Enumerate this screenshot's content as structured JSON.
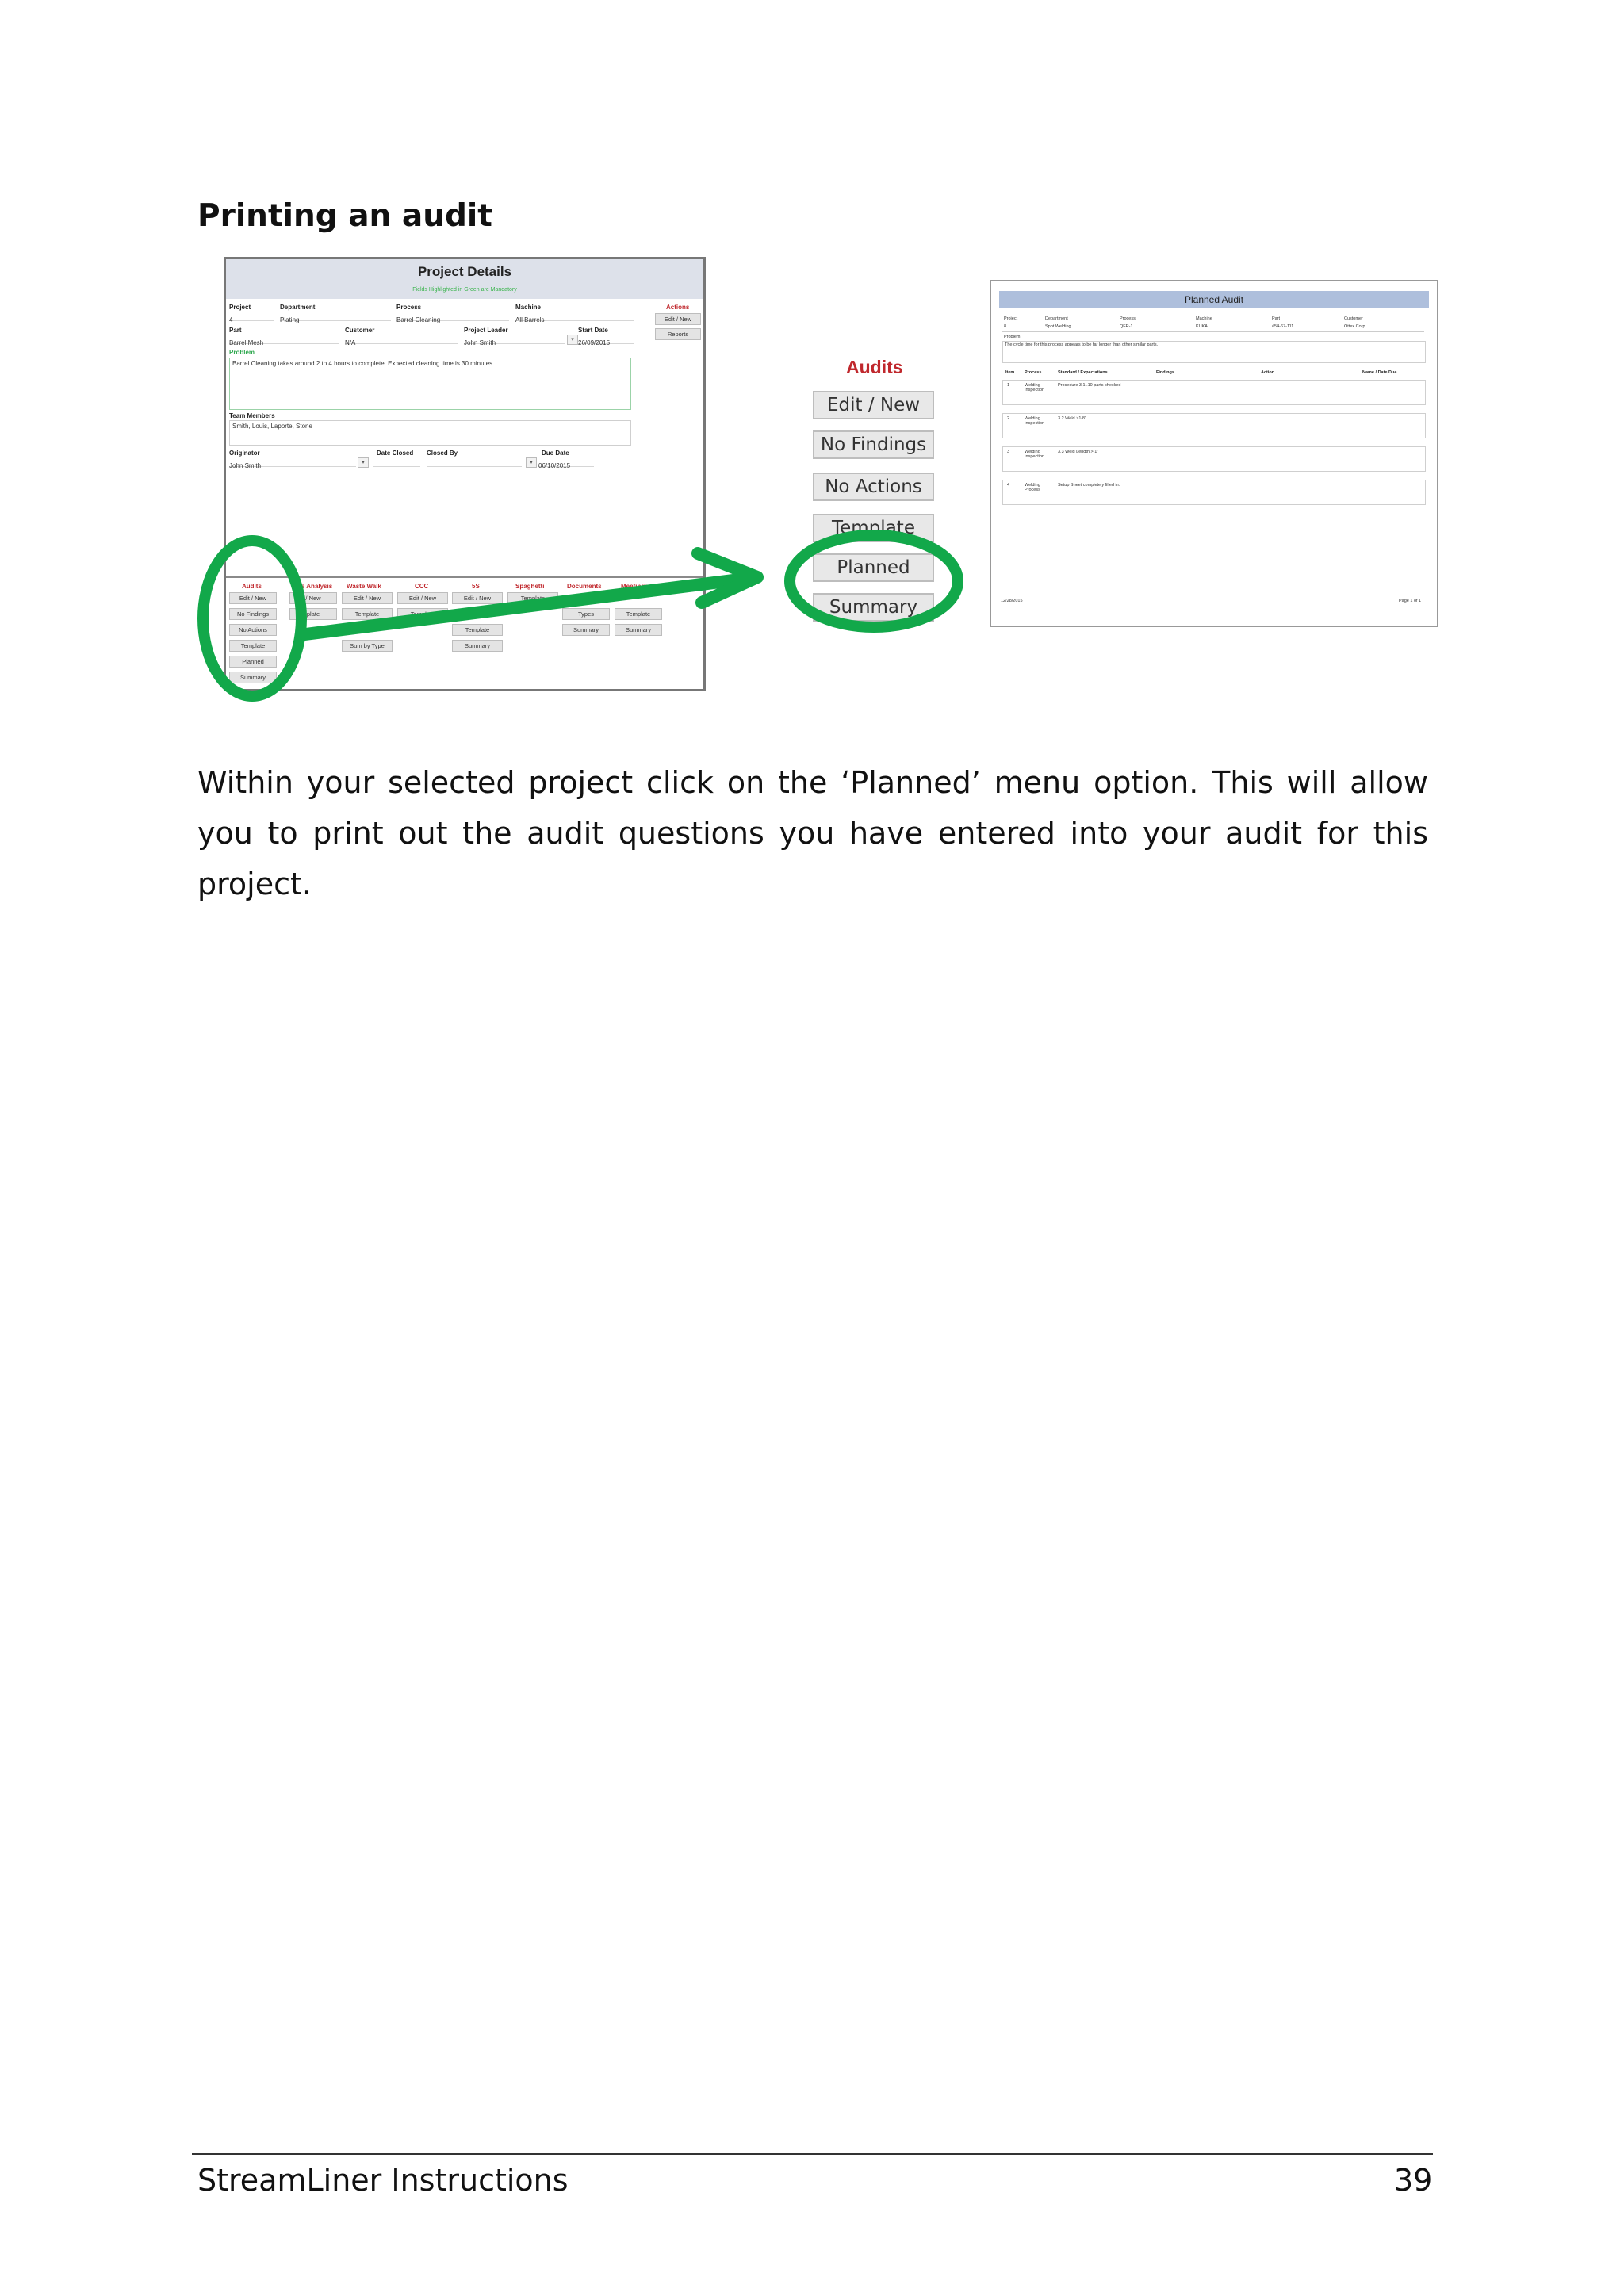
{
  "heading": "Printing an audit",
  "body_text": "Within your selected project click on the ‘Planned’ menu option. This will allow you to print out the audit questions you have entered into your audit for this project.",
  "footer": {
    "left": "StreamLiner Instructions",
    "right": "39"
  },
  "project_details": {
    "title": "Project Details",
    "subtitle": "Fields Highlighted in Green are Mandatory",
    "fields": {
      "project_label": "Project",
      "project_value": "4",
      "department_label": "Department",
      "department_value": "Plating",
      "process_label": "Process",
      "process_value": "Barrel Cleaning",
      "machine_label": "Machine",
      "machine_value": "All Barrels",
      "part_label": "Part",
      "part_value": "Barrel Mesh",
      "customer_label": "Customer",
      "customer_value": "N/A",
      "leader_label": "Project Leader",
      "leader_value": "John Smith",
      "start_label": "Start Date",
      "start_value": "26/09/2015",
      "problem_label": "Problem",
      "problem_value": "Barrel Cleaning takes around 2 to 4 hours to complete. Expected cleaning time is 30 minutes.",
      "team_label": "Team Members",
      "team_value": "Smith, Louis, Laporte, Stone",
      "originator_label": "Originator",
      "originator_value": "John Smith",
      "date_closed_label": "Date Closed",
      "closed_by_label": "Closed By",
      "due_label": "Due Date",
      "due_value": "06/10/2015"
    },
    "actions": {
      "label": "Actions",
      "edit_new": "Edit / New",
      "reports": "Reports"
    },
    "bottom_menu": {
      "audits": {
        "label": "Audits",
        "items": [
          "Edit / New",
          "No Findings",
          "No Actions",
          "Template",
          "Planned",
          "Summary"
        ]
      },
      "process_analysis": {
        "label": "ess Analysis",
        "items": [
          "/ New",
          "plate"
        ]
      },
      "waste_walk": {
        "label": "Waste Walk",
        "items": [
          "Edit / New",
          "Template",
          "Sum by Type"
        ]
      },
      "ccc": {
        "label": "CCC",
        "items": [
          "Edit / New",
          "Template"
        ]
      },
      "five_s": {
        "label": "5S",
        "items": [
          "Edit / New",
          "Template",
          "Summary"
        ]
      },
      "spaghetti": {
        "label": "Spaghetti",
        "items": [
          "Template"
        ]
      },
      "documents": {
        "label": "Documents",
        "items": [
          "Types",
          "Summary"
        ]
      },
      "meetings": {
        "label": "Meetings",
        "items": [
          "Template",
          "Summary"
        ]
      }
    }
  },
  "audits_menu": {
    "title": "Audits",
    "buttons": [
      "Edit / New",
      "No Findings",
      "No Actions",
      "Template",
      "Planned",
      "Summary"
    ]
  },
  "planned_audit": {
    "title": "Planned Audit",
    "header_labels": [
      "Project",
      "Department",
      "Process",
      "Machine",
      "Part",
      "Customer"
    ],
    "header_values": [
      "8",
      "Spot Welding",
      "QFR-1",
      "KUKA",
      "#54-67-111",
      "Ottex Corp"
    ],
    "problem_label": "Problem",
    "problem_value": "The cycle time for this process appears to be far longer than other similar parts.",
    "columns": [
      "Item",
      "Process",
      "Standard / Expectations",
      "Findings",
      "Action",
      "Name / Date Due"
    ],
    "rows": [
      {
        "item": "1",
        "process": "Welding Inspection",
        "standard": "Procedure 3.1..10 parts checked"
      },
      {
        "item": "2",
        "process": "Welding Inspection",
        "standard": "3.2 Weld >1/8\""
      },
      {
        "item": "3",
        "process": "Welding Inspection",
        "standard": "3.3 Weld Length > 1\""
      },
      {
        "item": "4",
        "process": "Welding Process",
        "standard": "Setup Sheet completely filled in."
      }
    ],
    "footer_date": "12/28/2015",
    "footer_page": "Page 1 of 1"
  },
  "colors": {
    "annotation_green": "#12a84a",
    "label_red": "#c0282d",
    "report_header_blue": "#aebfdc"
  }
}
